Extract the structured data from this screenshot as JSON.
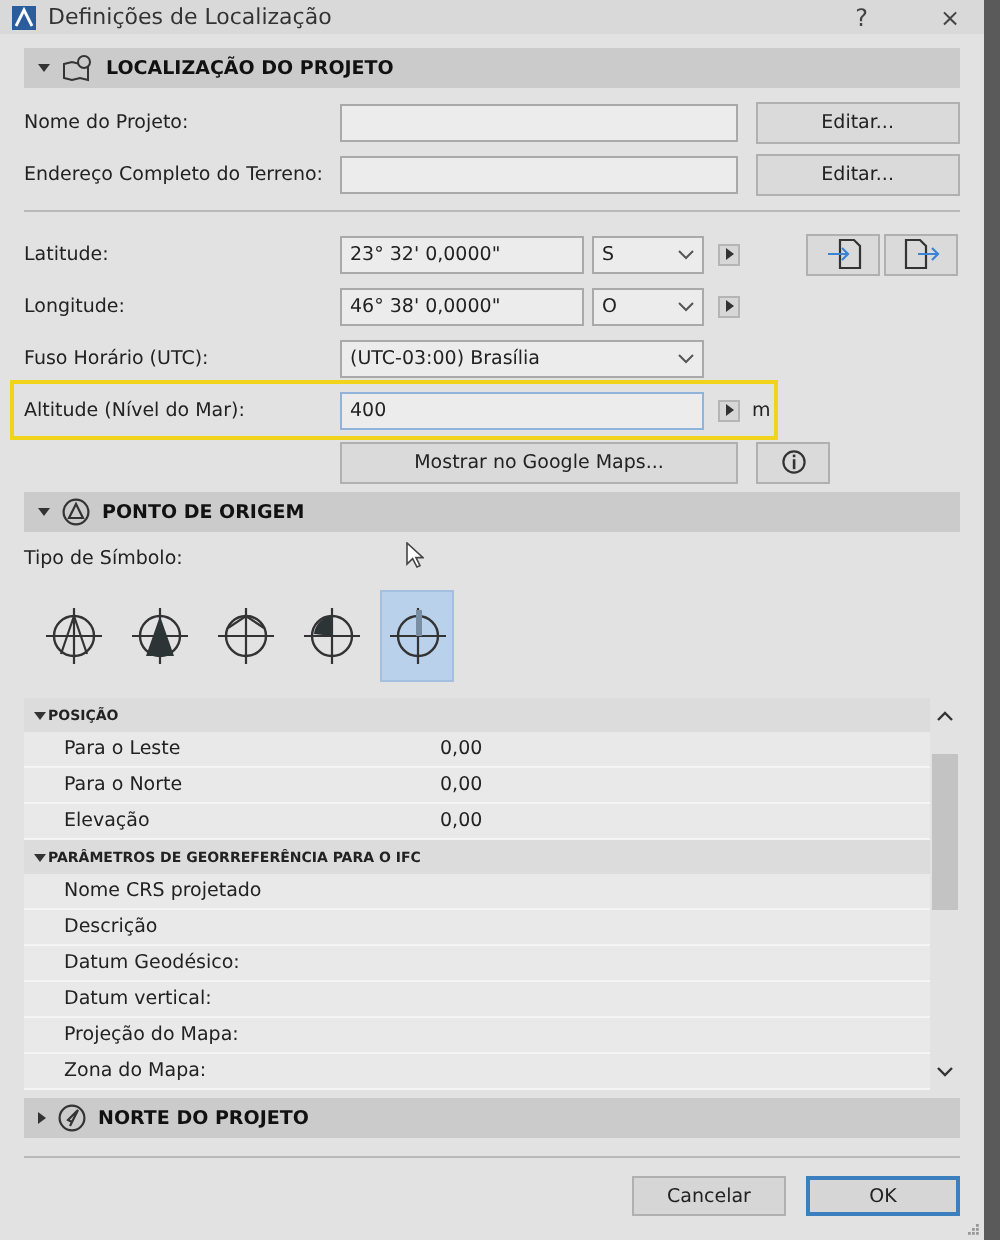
{
  "window": {
    "title": "Definições de Localização",
    "help": "?",
    "close": "×"
  },
  "location_section": {
    "title": "LOCALIZAÇÃO DO PROJETO",
    "expanded": true,
    "rows": [
      {
        "kind": "edit",
        "label": "Nome do Projeto:",
        "button": "Editar..."
      },
      {
        "kind": "edit",
        "label": "Endereço Completo do Terreno:",
        "button": "Editar..."
      },
      {
        "kind": "coord",
        "label": "Latitude:",
        "value": "23° 32' 0,0000\"",
        "direction": "S"
      },
      {
        "kind": "coord",
        "label": "Longitude:",
        "value": "46° 38' 0,0000\"",
        "direction": "O"
      },
      {
        "kind": "select",
        "label": "Fuso Horário (UTC):",
        "value": "(UTC-03:00) Brasília"
      },
      {
        "kind": "altitude",
        "label": "Altitude (Nível do Mar):",
        "value": "400",
        "unit": "m",
        "highlighted": true
      }
    ],
    "maps_button": "Mostrar no Google Maps..."
  },
  "origin_section": {
    "title": "PONTO DE ORIGEM",
    "expanded": true,
    "symbol_label": "Tipo de Símbolo:",
    "symbols": [
      {
        "kind": "open-triangle",
        "selected": false
      },
      {
        "kind": "filled-triangle",
        "selected": false
      },
      {
        "kind": "arc-cross",
        "selected": false
      },
      {
        "kind": "quarter",
        "selected": false
      },
      {
        "kind": "bar-cross",
        "selected": true
      }
    ],
    "groups": [
      {
        "title": "POSIÇÃO",
        "expanded": true,
        "rows": [
          {
            "name": "Para o Leste",
            "value": "0,00"
          },
          {
            "name": "Para o Norte",
            "value": "0,00"
          },
          {
            "name": "Elevação",
            "value": "0,00"
          }
        ]
      },
      {
        "title": "PARÂMETROS DE GEORREFERÊNCIA PARA O IFC",
        "expanded": true,
        "rows": [
          {
            "name": "Nome CRS projetado"
          },
          {
            "name": "Descrição"
          },
          {
            "name": "Datum Geodésico:"
          },
          {
            "name": "Datum vertical:"
          },
          {
            "name": "Projeção do Mapa:"
          },
          {
            "name": "Zona do Mapa:"
          }
        ]
      }
    ]
  },
  "north_section": {
    "title": "NORTE DO PROJETO",
    "expanded": false
  },
  "buttons": [
    {
      "label": "Cancelar",
      "default": false
    },
    {
      "label": "OK",
      "default": true
    }
  ]
}
